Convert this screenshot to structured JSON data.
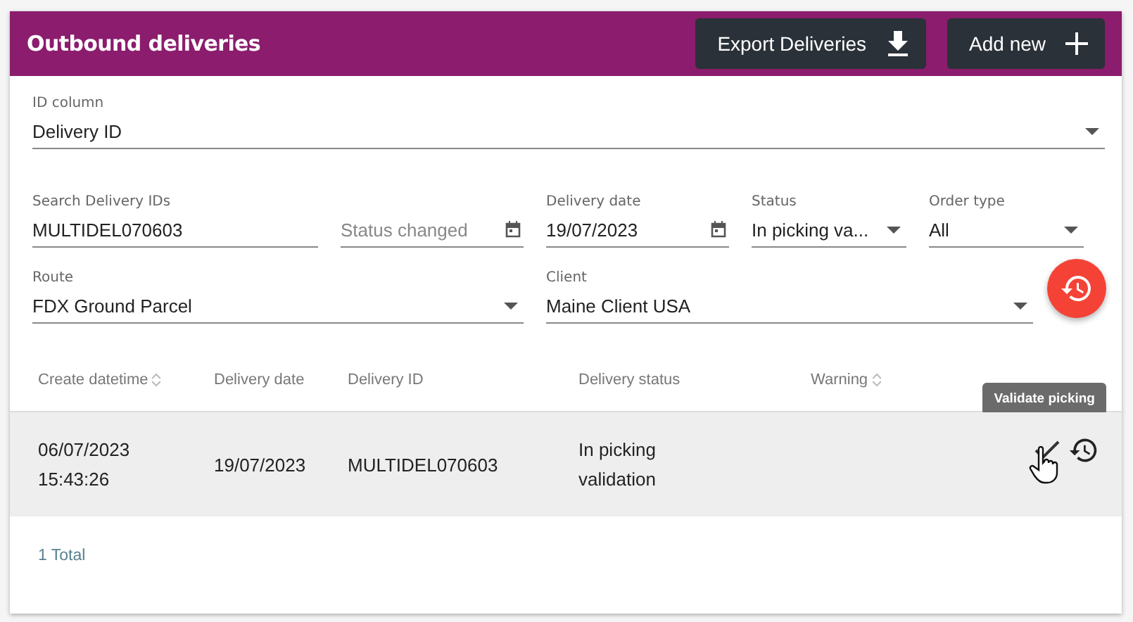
{
  "header": {
    "title": "Outbound deliveries",
    "buttons": [
      {
        "label": "Export Deliveries",
        "kind": "download"
      },
      {
        "label": "Add new",
        "kind": "add"
      }
    ]
  },
  "id_column": {
    "label": "ID column",
    "value": "Delivery ID"
  },
  "filters": [
    {
      "kind": "text",
      "label": "Search Delivery IDs",
      "value": "MULTIDEL070603"
    },
    {
      "kind": "date",
      "placeholder": "Status changed"
    },
    {
      "kind": "date",
      "label": "Delivery date",
      "value": "19/07/2023"
    },
    {
      "kind": "select",
      "label": "Status",
      "value": "In picking va..."
    },
    {
      "kind": "select",
      "label": "Order type",
      "value": "All"
    }
  ],
  "filters_2": [
    {
      "kind": "select",
      "label": "Route",
      "value": "FDX Ground Parcel"
    },
    {
      "kind": "select",
      "label": "Client",
      "value": "Maine Client USA"
    }
  ],
  "table": {
    "columns": [
      {
        "label": "Create datetime",
        "sortable": true
      },
      {
        "label": "Delivery date",
        "sortable": false
      },
      {
        "label": "Delivery ID",
        "sortable": false
      },
      {
        "label": "Delivery status",
        "sortable": false
      },
      {
        "label": "Warning",
        "sortable": true
      }
    ],
    "rows": [
      {
        "create_datetime": [
          "06/07/2023",
          "15:43:26"
        ],
        "delivery_date": "19/07/2023",
        "delivery_id": "MULTIDEL070603",
        "delivery_status": [
          "In picking",
          "validation"
        ],
        "hovered": true
      }
    ],
    "tooltip": "Validate picking",
    "total": "1 Total"
  }
}
